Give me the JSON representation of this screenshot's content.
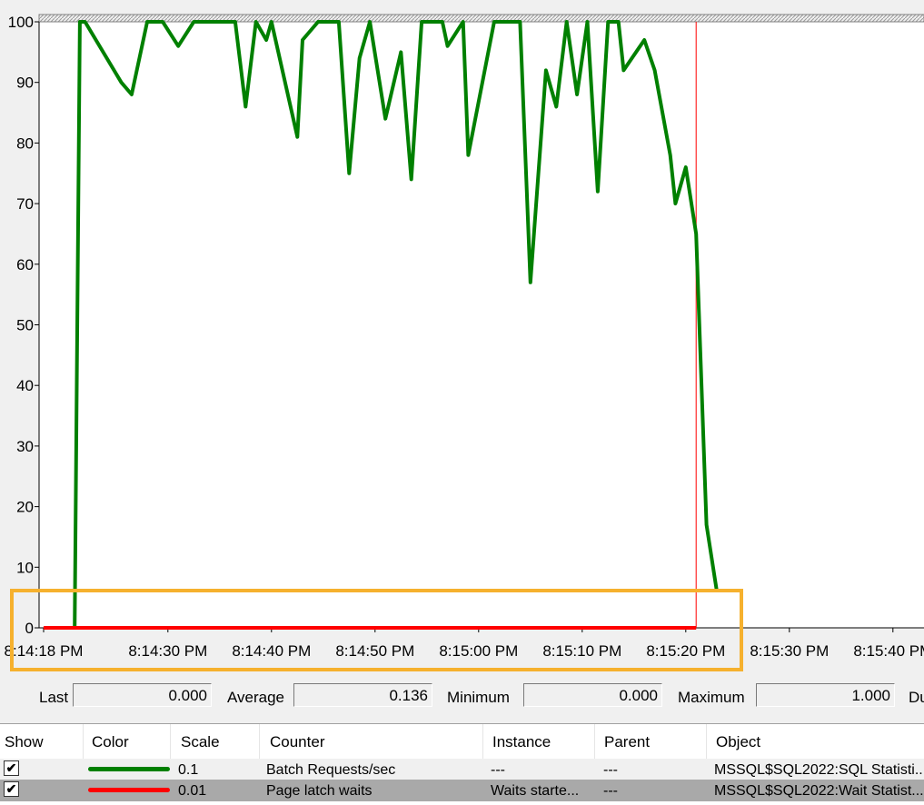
{
  "chart_data": {
    "type": "line",
    "y_ticks": [
      100,
      90,
      80,
      70,
      60,
      50,
      40,
      30,
      20,
      10,
      0
    ],
    "x_tick_labels": [
      "8:14:18 PM",
      "8:14:30 PM",
      "8:14:40 PM",
      "8:14:50 PM",
      "8:15:00 PM",
      "8:15:10 PM",
      "8:15:20 PM",
      "8:15:30 PM",
      "8:15:40 PM"
    ],
    "x_tick_times": [
      0,
      12,
      22,
      32,
      42,
      52,
      62,
      72,
      82
    ],
    "ylim": [
      0,
      100
    ],
    "current_time_marker": 63,
    "series": [
      {
        "name": "Batch Requests/sec",
        "color": "#008000",
        "x": [
          0,
          3,
          3.5,
          4,
          7.5,
          8.5,
          10,
          11.5,
          13,
          14.5,
          17,
          18.5,
          19.5,
          20.5,
          21.5,
          22,
          24.5,
          25,
          26.5,
          27.5,
          28.5,
          29.5,
          30.5,
          31.5,
          33,
          34.5,
          35.5,
          36.5,
          38.5,
          39,
          40.5,
          41,
          43.5,
          44.5,
          46,
          47,
          48.5,
          49.5,
          50.5,
          51.5,
          52.5,
          53.5,
          54.5,
          55.5,
          56,
          58,
          59,
          60.5,
          61,
          62,
          63,
          64,
          65
        ],
        "values": [
          0,
          0,
          100,
          100,
          90,
          88,
          100,
          100,
          96,
          100,
          100,
          100,
          86,
          100,
          97,
          100,
          81,
          97,
          100,
          100,
          100,
          75,
          94,
          100,
          84,
          95,
          74,
          100,
          100,
          96,
          100,
          78,
          100,
          100,
          100,
          57,
          92,
          86,
          100,
          88,
          100,
          72,
          100,
          100,
          92,
          97,
          92,
          78,
          70,
          76,
          65,
          17,
          6
        ]
      },
      {
        "name": "Page latch waits",
        "color": "#ff0000",
        "x": [
          0,
          63
        ],
        "values": [
          0,
          0
        ]
      }
    ]
  },
  "stats": {
    "last_label": "Last",
    "last_value": "0.000",
    "average_label": "Average",
    "average_value": "0.136",
    "minimum_label": "Minimum",
    "minimum_value": "0.000",
    "maximum_label": "Maximum",
    "maximum_value": "1.000",
    "duration_label": "Du"
  },
  "table": {
    "headers": {
      "show": "Show",
      "color": "Color",
      "scale": "Scale",
      "counter": "Counter",
      "instance": "Instance",
      "parent": "Parent",
      "object": "Object"
    },
    "rows": [
      {
        "checked": "✔",
        "color": "#008000",
        "scale": "0.1",
        "counter": "Batch Requests/sec",
        "instance": "---",
        "parent": "---",
        "object": "MSSQL$SQL2022:SQL Statisti..."
      },
      {
        "checked": "✔",
        "color": "#ff0000",
        "scale": "0.01",
        "counter": "Page latch waits",
        "instance": "Waits starte...",
        "parent": "---",
        "object": "MSSQL$SQL2022:Wait Statist..."
      }
    ]
  },
  "highlight_color": "#f6b12e"
}
